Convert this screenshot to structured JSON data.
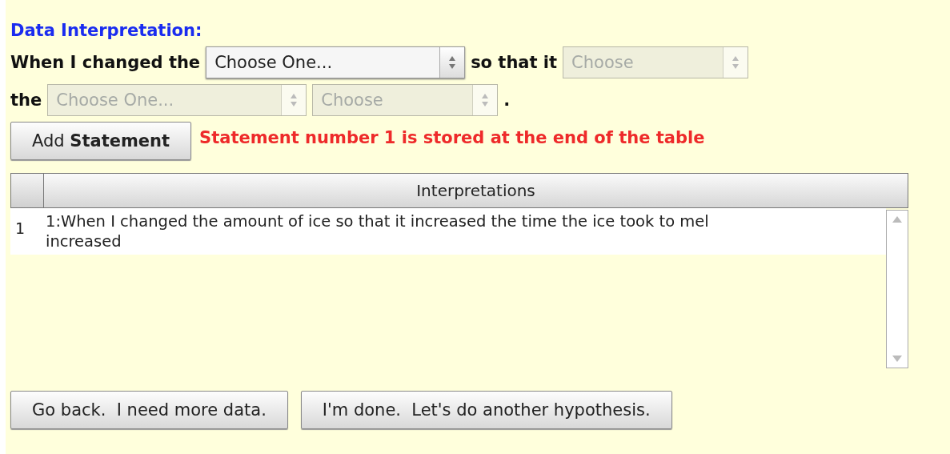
{
  "heading": "Data Interpretation:",
  "sentence_lines": [
    [
      {
        "kind": "text",
        "text": "When I changed the"
      },
      {
        "kind": "select",
        "value": "Choose One...",
        "disabled": false
      },
      {
        "kind": "text",
        "text": "so that it"
      },
      {
        "kind": "select",
        "value": "Choose",
        "disabled": true
      }
    ],
    [
      {
        "kind": "text",
        "text": "the"
      },
      {
        "kind": "select",
        "value": "Choose One...",
        "disabled": true
      },
      {
        "kind": "select",
        "value": "Choose",
        "disabled": true
      },
      {
        "kind": "text",
        "text": "."
      }
    ]
  ],
  "add_button": "Add **Statement**",
  "message": "Statement number 1 is stored at the end of the table",
  "table": {
    "columns": [
      "Interpretations"
    ],
    "rows": [
      {
        "number": "1",
        "lines": [
          "1:When I changed the amount of ice so that it increased the time the ice took to mel",
          "increased"
        ]
      }
    ]
  },
  "buttons": [
    "Go back.  I need more data.",
    "I'm done.  Let's do another hypothesis."
  ]
}
